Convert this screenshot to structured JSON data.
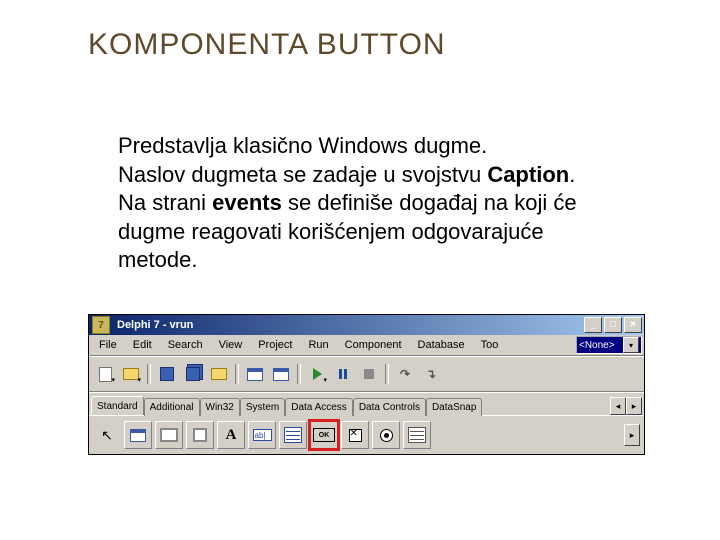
{
  "slide": {
    "title": "KOMPONENTA BUTTON",
    "para1": "Predstavlja klasično Windows dugme.",
    "para2_a": "Naslov dugmeta se zadaje u svojstvu ",
    "para2_b": "Caption",
    "para2_c": ".",
    "para3_a": "Na strani ",
    "para3_b": "events",
    "para3_c": " se definiše događaj na koji će dugme reagovati korišćenjem odgovarajuće metode."
  },
  "ide": {
    "title": "Delphi 7 - vrun",
    "menu": [
      "File",
      "Edit",
      "Search",
      "View",
      "Project",
      "Run",
      "Component",
      "Database",
      "Too"
    ],
    "dropdown": "<None>",
    "tabs": [
      "Standard",
      "Additional",
      "Win32",
      "System",
      "Data Access",
      "Data Controls",
      "DataSnap"
    ],
    "ok_label": "OK"
  }
}
